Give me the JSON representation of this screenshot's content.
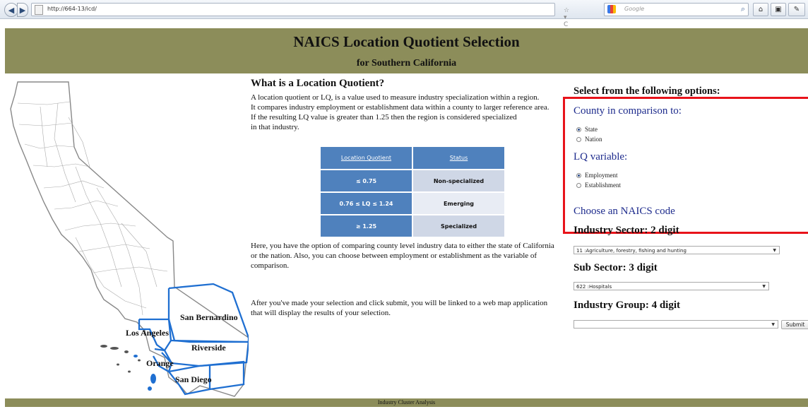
{
  "browser": {
    "url": "http://664-13/icd/",
    "search_placeholder": "Google"
  },
  "header": {
    "title": "NAICS Location Quotient Selection",
    "subtitle": "for Southern California"
  },
  "map": {
    "counties": [
      "San Bernardino",
      "Los Angeles",
      "Riverside",
      "Orange",
      "San Diego"
    ]
  },
  "info": {
    "heading": "What is a Location Quotient?",
    "para1": [
      "A location quotient or LQ, is a value used to measure industry specialization within a region.",
      "It compares industry employment or establishment data within a county to larger reference area.",
      "If the resulting LQ value is greater than 1.25 then the region is considered specialized",
      "in that industry."
    ],
    "table": {
      "headers": [
        "Location Quotient",
        "Status"
      ],
      "rows": [
        [
          "≤ 0.75",
          "Non-specialized"
        ],
        [
          "0.76 ≤ LQ ≤ 1.24",
          "Emerging"
        ],
        [
          "≥ 1.25",
          "Specialized"
        ]
      ]
    },
    "para2": [
      "Here, you have the option of comparing county level industry data to either the state of California",
      "or the nation. Also, you can choose between employment or establishment as the variable of",
      "comparison."
    ],
    "para3": [
      "After you've made your selection and click submit, you will be linked to a web map application",
      "that will display the results of your selection."
    ]
  },
  "options": {
    "heading": "Select from the following options:",
    "comparison_heading": "County in comparison to:",
    "comparison_options": [
      "State",
      "Nation"
    ],
    "comparison_selected": "State",
    "variable_heading": "LQ variable:",
    "variable_options": [
      "Employment",
      "Establishment"
    ],
    "variable_selected": "Employment",
    "naics_heading": "Choose an NAICS code",
    "sector_heading": "Industry Sector: 2 digit",
    "sector_value": "11 :Agriculture, forestry, fishing and hunting",
    "subsector_heading": "Sub Sector: 3 digit",
    "subsector_value": "622 :Hospitals",
    "group_heading": "Industry Group: 4 digit",
    "group_value": "",
    "submit_label": "Submit"
  },
  "footer": {
    "text": "Industry Cluster Analysis"
  },
  "colors": {
    "header_bg": "#8c8d5a",
    "county_outline": "#1f6fd1",
    "table_blue": "#4f81bd",
    "highlight": "#e8131a",
    "option_heading": "#1c2a8c"
  }
}
